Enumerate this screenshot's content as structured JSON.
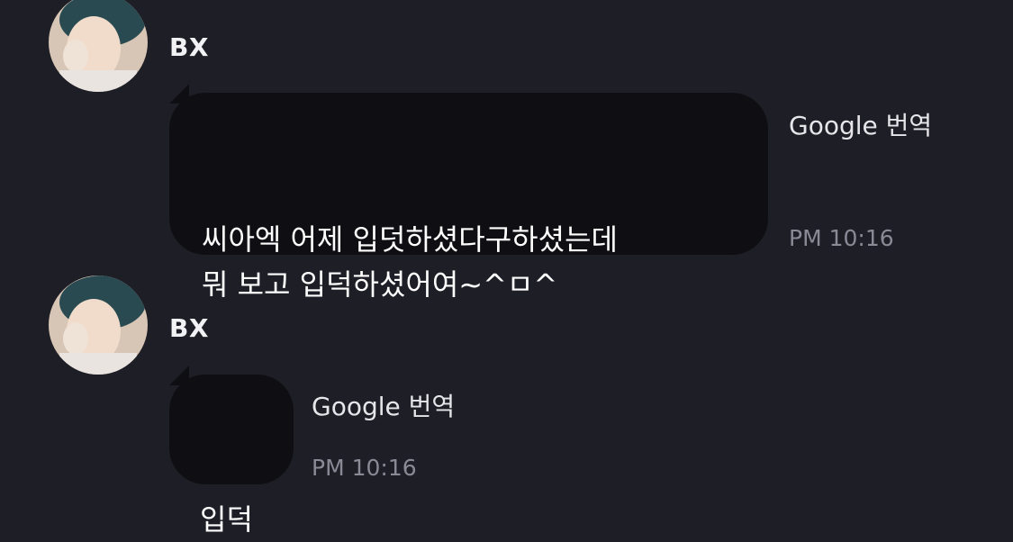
{
  "messages": [
    {
      "sender": "BX",
      "text": "씨아엑 어제 입덧하셨다구하셨는데\n뭐 보고 입덕하셨어여~^ㅁ^",
      "translate_label": "Google 번역",
      "time": "PM 10:16"
    },
    {
      "sender": "BX",
      "text": "입덕",
      "translate_label": "Google 번역",
      "time": "PM 10:16"
    }
  ],
  "colors": {
    "background": "#1e1e26",
    "bubble": "#0f0f13",
    "timestamp": "#8a8a96"
  },
  "icons": {
    "avatar": "profile-photo"
  }
}
